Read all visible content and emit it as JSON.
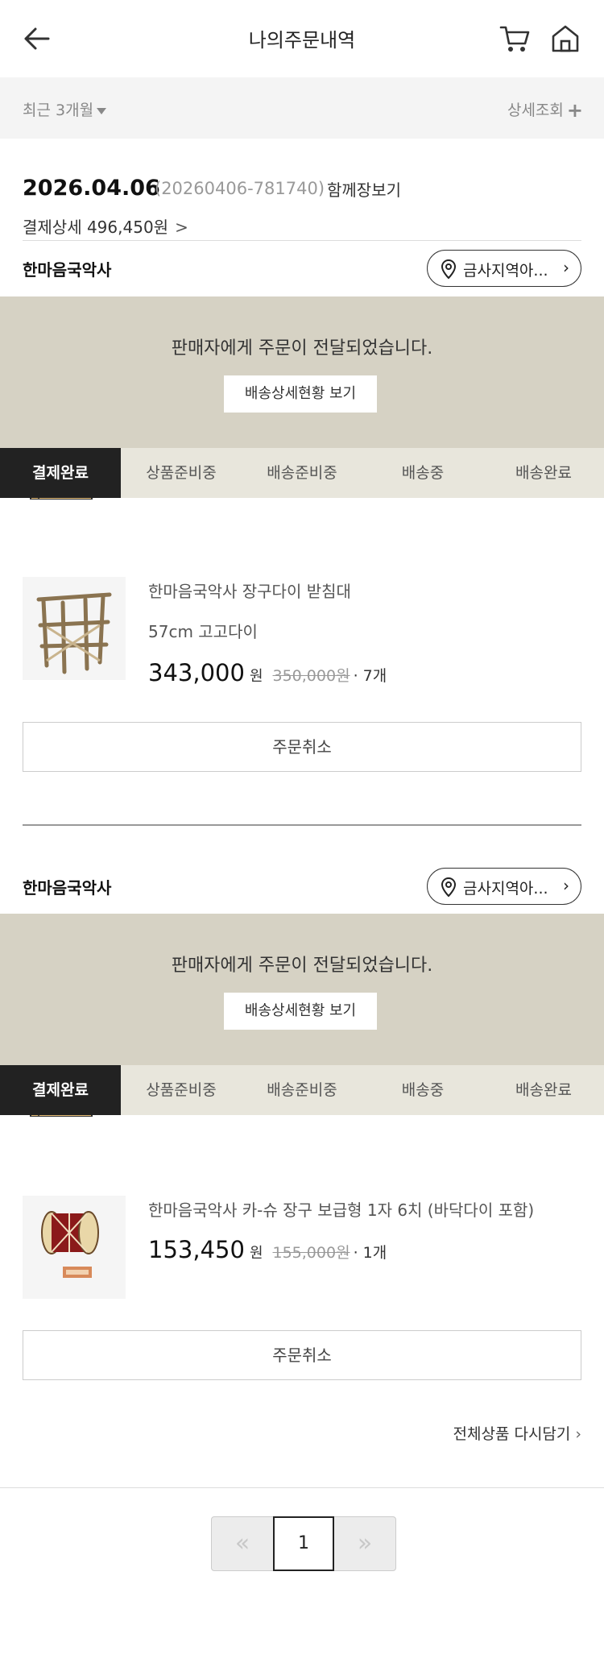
{
  "header": {
    "title": "나의주문내역",
    "back_icon": "arrow-left-icon",
    "cart_icon": "cart-icon",
    "home_icon": "home-icon"
  },
  "filter": {
    "period_label": "최근 3개월",
    "detail_label": "상세조회",
    "detail_plus": "+"
  },
  "order": {
    "date": "2026.04.06",
    "order_number": "(20260406-781740)",
    "together_label": "함께장보기",
    "pay_detail_label": "결제상세 496,450원",
    "chevron": ">"
  },
  "groups": [
    {
      "shop_name": "한마음국악사",
      "location_label": "금사지역아...",
      "status_message": "판매자에게 주문이 전달되었습니다.",
      "track_label": "배송상세현황 보기",
      "steps": [
        "결제완료",
        "상품준비중",
        "배송준비중",
        "배송중",
        "배송완료"
      ],
      "active_step": 0,
      "product": {
        "name": "한마음국악사 장구다이 받침대",
        "option": "57cm 고고다이",
        "price": "343,000",
        "won": "원",
        "original_price": "350,000원",
        "qty": "· 7개"
      },
      "cancel_label": "주문취소"
    },
    {
      "shop_name": "한마음국악사",
      "location_label": "금사지역아...",
      "status_message": "판매자에게 주문이 전달되었습니다.",
      "track_label": "배송상세현황 보기",
      "steps": [
        "결제완료",
        "상품준비중",
        "배송준비중",
        "배송중",
        "배송완료"
      ],
      "active_step": 0,
      "product": {
        "name": "한마음국악사 카-슈 장구 보급형 1자 6치 (바닥다이 포함)",
        "option": "",
        "price": "153,450",
        "won": "원",
        "original_price": "155,000원",
        "qty": "· 1개"
      },
      "cancel_label": "주문취소"
    }
  ],
  "reorder_label": "전체상품 다시담기",
  "pagination": {
    "prev": "«",
    "current_page": "1",
    "next": "»"
  },
  "colors": {
    "status_panel_bg": "#d6d2c4",
    "active_step_bg": "#222222",
    "box_color": "#e8c07a"
  }
}
